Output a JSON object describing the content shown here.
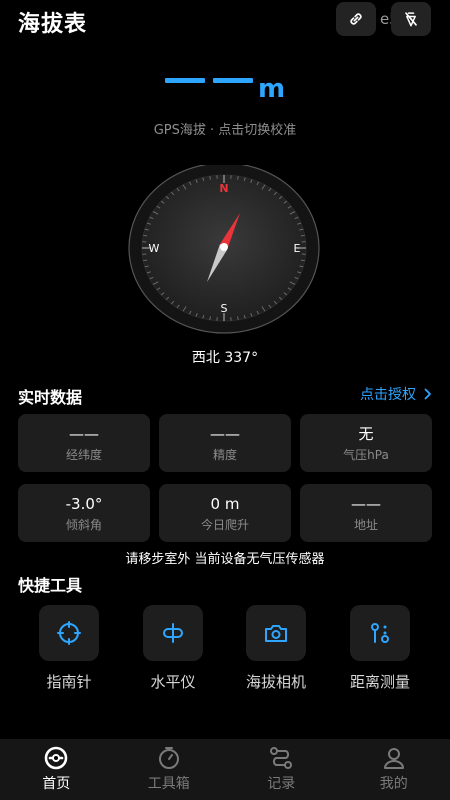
{
  "header": {
    "title": "海拔表",
    "id_text": "e5918"
  },
  "altitude": {
    "value": "——",
    "unit": "m",
    "hint": "GPS海拔 · 点击切换校准"
  },
  "compass": {
    "north": "N",
    "south": "S",
    "east": "E",
    "west": "W",
    "heading_text": "西北 337°",
    "heading_deg": 337
  },
  "realtime": {
    "title": "实时数据",
    "auth_label": "点击授权",
    "cards": [
      {
        "value": "——",
        "label": "经纬度"
      },
      {
        "value": "——",
        "label": "精度"
      },
      {
        "value": "无",
        "label": "气压hPa"
      },
      {
        "value": "-3.0°",
        "label": "倾斜角"
      },
      {
        "value": "0 m",
        "label": "今日爬升"
      },
      {
        "value": "——",
        "label": "地址"
      }
    ],
    "notice": "请移步室外 当前设备无气压传感器"
  },
  "tools": {
    "title": "快捷工具",
    "items": [
      {
        "label": "指南针",
        "icon": "crosshair-icon"
      },
      {
        "label": "水平仪",
        "icon": "level-icon"
      },
      {
        "label": "海拔相机",
        "icon": "camera-icon"
      },
      {
        "label": "距离测量",
        "icon": "distance-icon"
      }
    ]
  },
  "nav": {
    "items": [
      {
        "label": "首页",
        "icon": "home-icon",
        "active": true
      },
      {
        "label": "工具箱",
        "icon": "toolbox-icon",
        "active": false
      },
      {
        "label": "记录",
        "icon": "record-icon",
        "active": false
      },
      {
        "label": "我的",
        "icon": "profile-icon",
        "active": false
      }
    ]
  },
  "colors": {
    "accent": "#2ea6ff",
    "needle_north": "#e8343a",
    "card_bg": "#1e1e1e",
    "background": "#000000"
  }
}
